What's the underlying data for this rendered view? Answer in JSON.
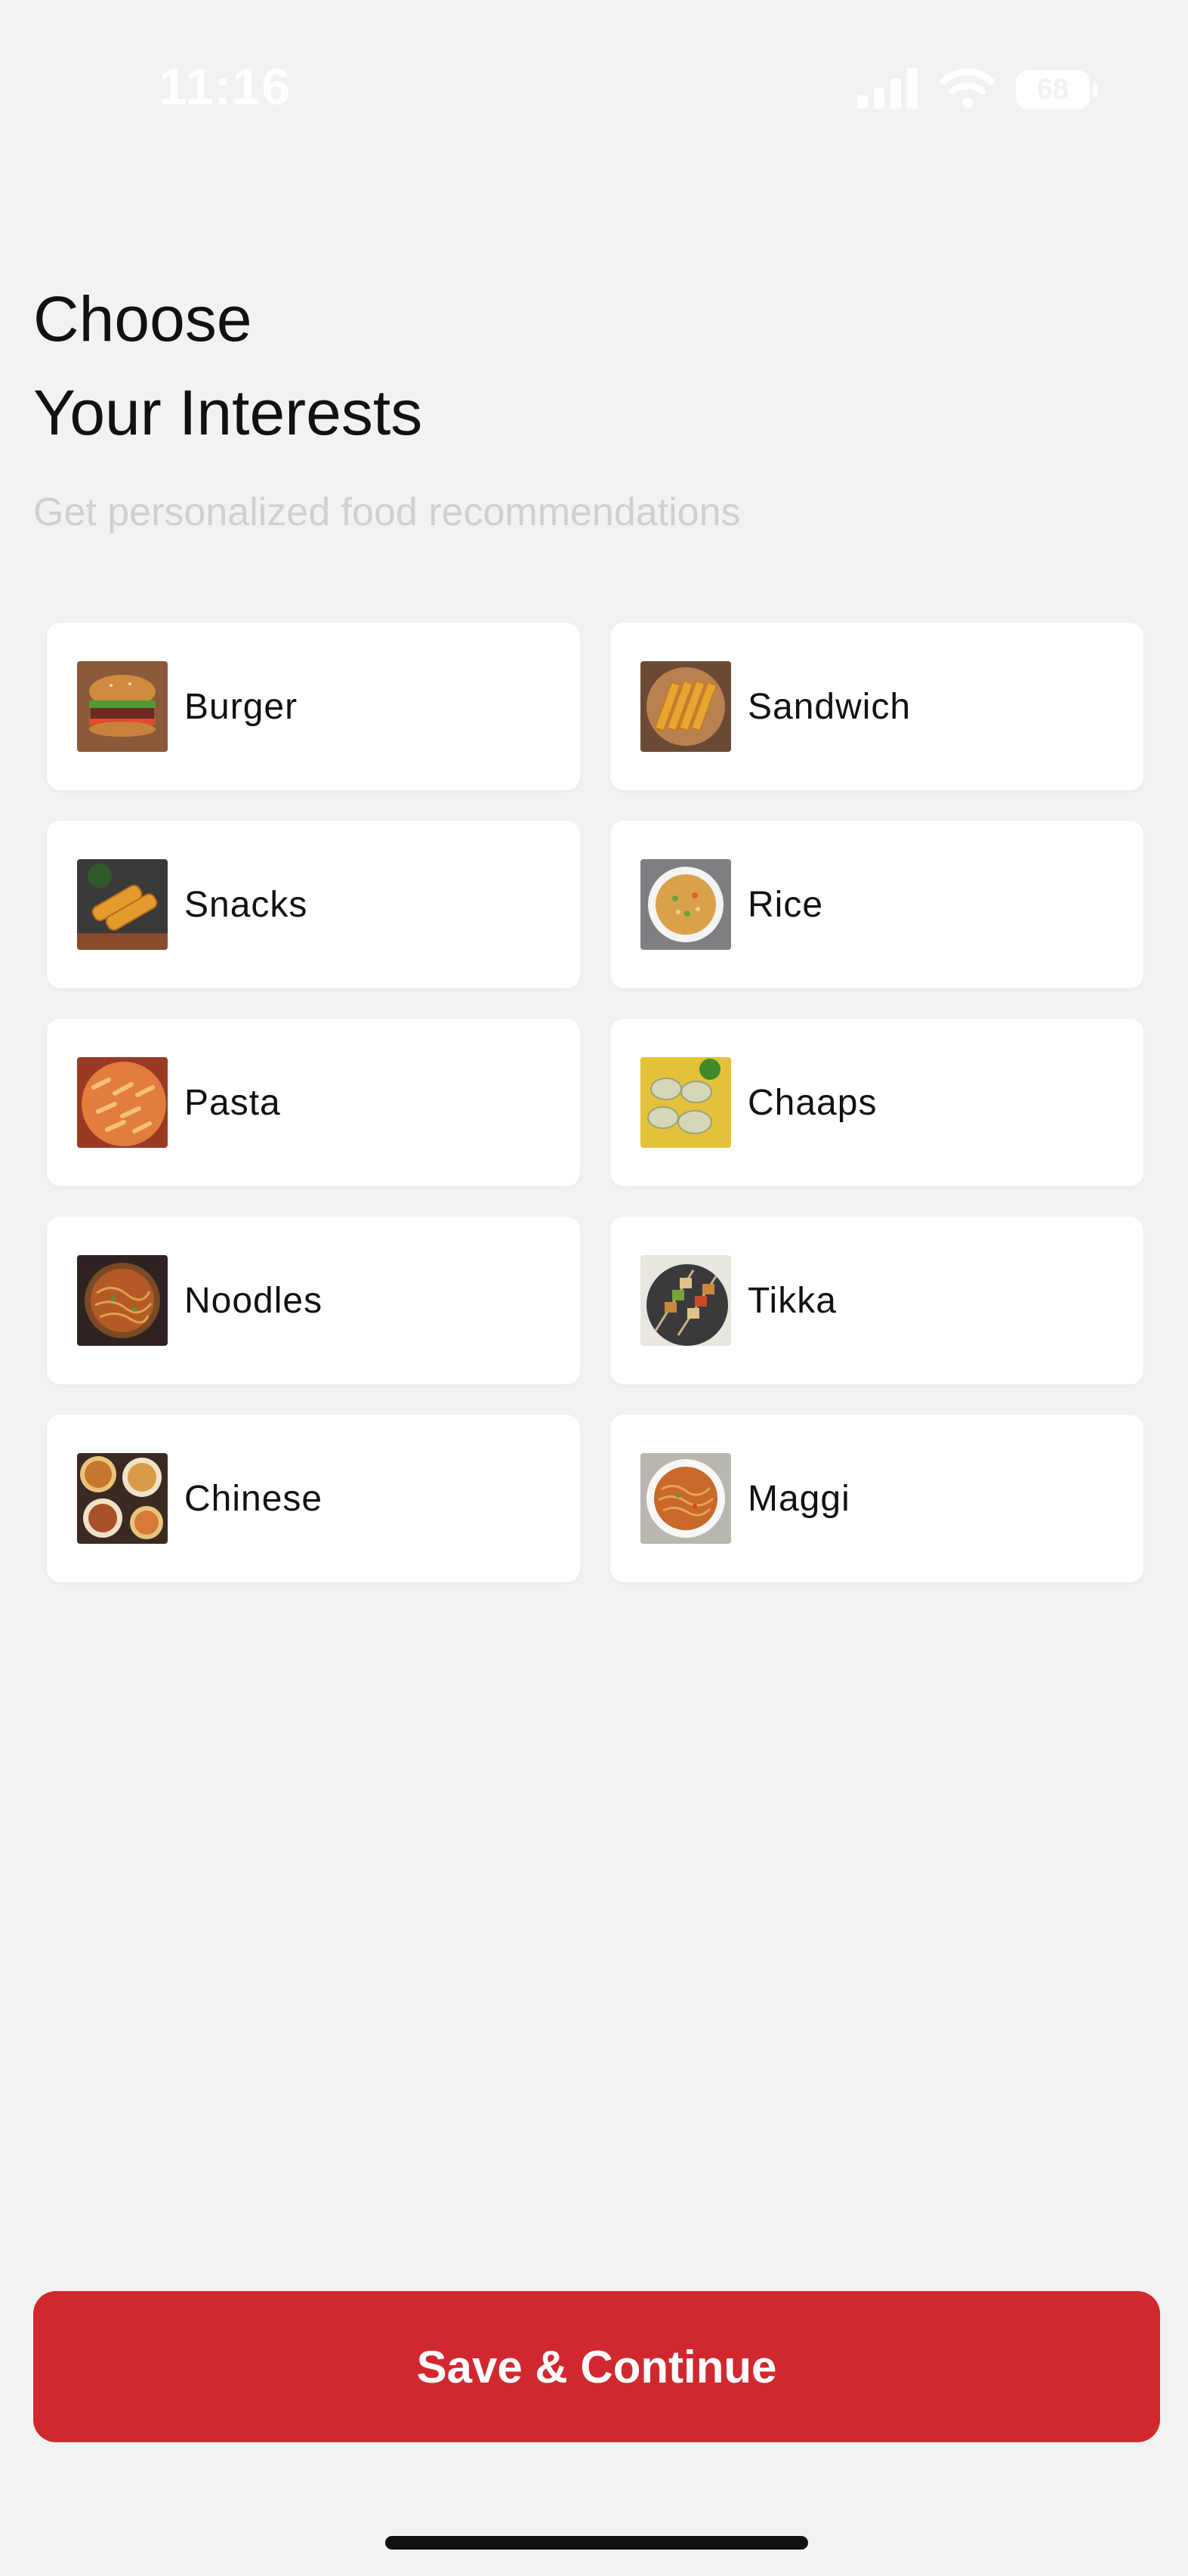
{
  "status_bar": {
    "time": "11:16",
    "battery": "68",
    "icons": [
      "signal-icon",
      "wifi-icon",
      "battery-icon"
    ]
  },
  "header": {
    "title_line1": "Choose",
    "title_line2": "Your Interests",
    "subtitle": "Get personalized food recommendations"
  },
  "interests": [
    {
      "label": "Burger",
      "icon": "burger-image"
    },
    {
      "label": "Sandwich",
      "icon": "sandwich-image"
    },
    {
      "label": "Snacks",
      "icon": "snacks-image"
    },
    {
      "label": "Rice",
      "icon": "rice-image"
    },
    {
      "label": "Pasta",
      "icon": "pasta-image"
    },
    {
      "label": "Chaaps",
      "icon": "chaaps-image"
    },
    {
      "label": "Noodles",
      "icon": "noodles-image"
    },
    {
      "label": "Tikka",
      "icon": "tikka-image"
    },
    {
      "label": "Chinese",
      "icon": "chinese-image"
    },
    {
      "label": "Maggi",
      "icon": "maggi-image"
    }
  ],
  "footer": {
    "save_label": "Save & Continue"
  },
  "colors": {
    "background": "#f2f2f2",
    "accent": "#d1282f",
    "card": "#ffffff",
    "subtitle": "#cfcfd4"
  }
}
